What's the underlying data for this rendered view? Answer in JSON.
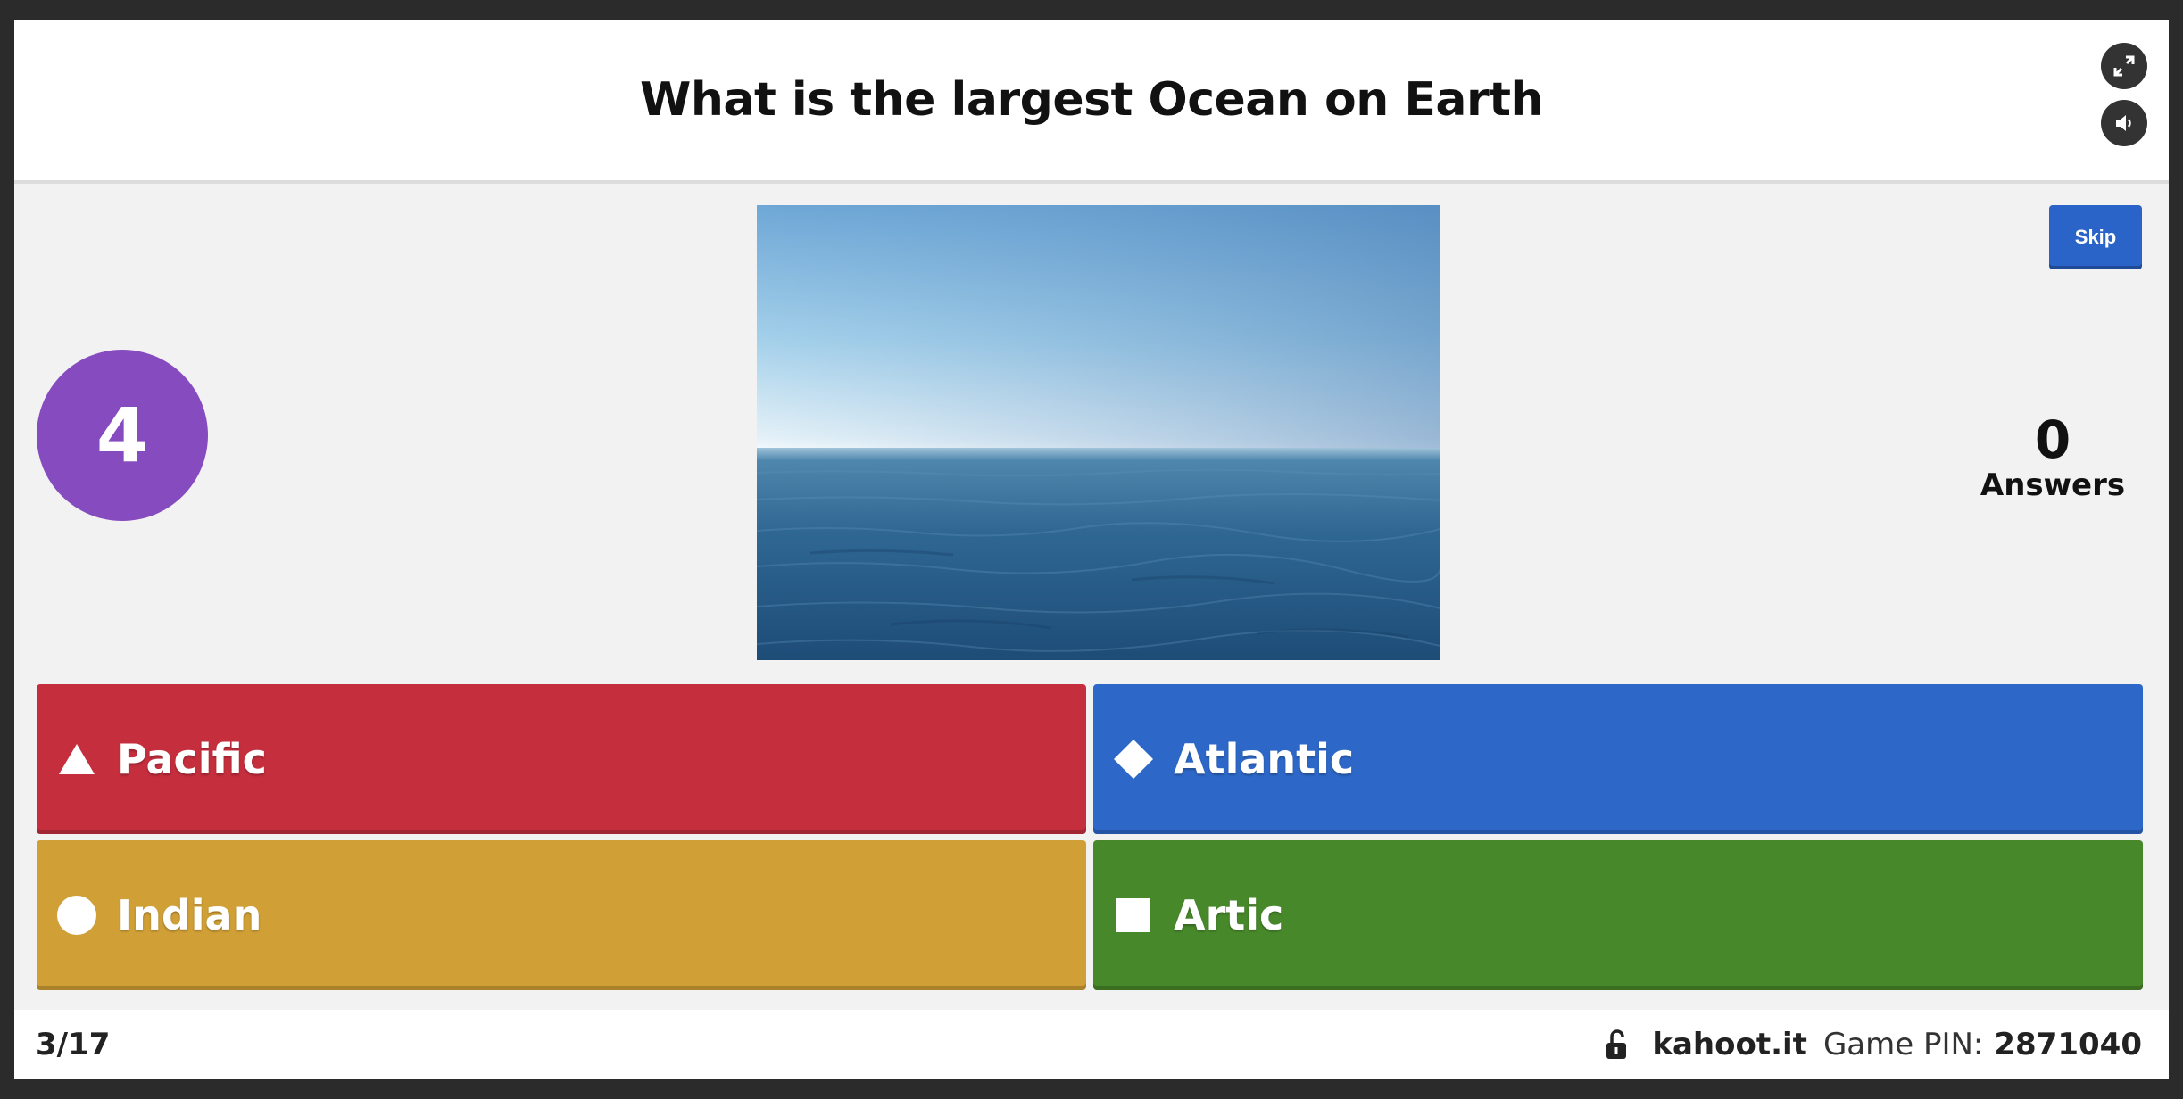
{
  "question": "What is the largest Ocean on Earth",
  "controls": {
    "fullscreen_icon": "fullscreen-icon",
    "sound_icon": "speaker-icon",
    "skip_label": "Skip"
  },
  "timer": {
    "value": "4",
    "color": "#864cbf"
  },
  "answers_count": {
    "value": "0",
    "label": "Answers"
  },
  "answers": [
    {
      "shape": "triangle",
      "label": "Pacific",
      "color": "#c52e3d"
    },
    {
      "shape": "diamond",
      "label": "Atlantic",
      "color": "#2d68c8"
    },
    {
      "shape": "circle",
      "label": "Indian",
      "color": "#d09f36"
    },
    {
      "shape": "square",
      "label": "Artic",
      "color": "#47882a"
    }
  ],
  "footer": {
    "progress": "3/17",
    "lock_icon": "unlocked-padlock-icon",
    "site": "kahoot.it",
    "pin_label": "Game PIN:",
    "pin_value": "2871040"
  }
}
